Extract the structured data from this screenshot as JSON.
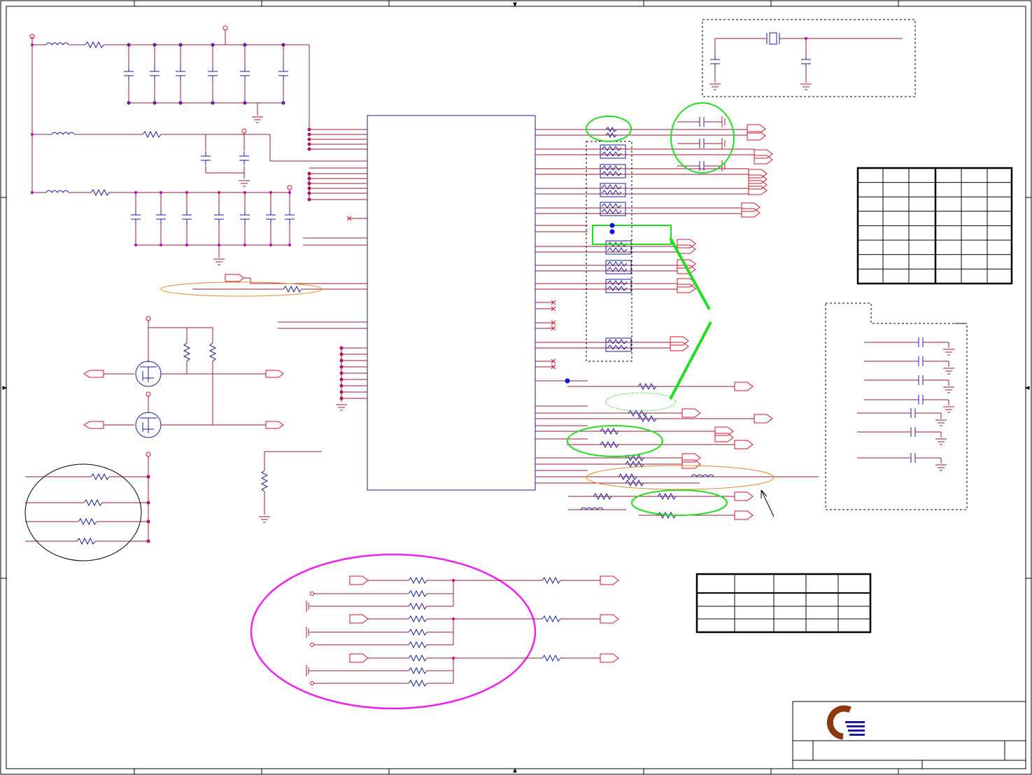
{
  "sheet": {
    "title": "",
    "border_color": "#000000",
    "wire_color": "#9b1b30",
    "net_color": "#d4102a",
    "component_color": "#1a1aa0",
    "junction_color": "#c000c0",
    "highlight_green": "#22dd22",
    "highlight_magenta": "#ee22ee",
    "highlight_orange": "#e08a2a"
  },
  "title_block": {
    "logo": "company-logo",
    "rows": 3
  },
  "tables": {
    "right_table": {
      "rows": 8,
      "cols": 6
    },
    "bottom_table": {
      "rows": 3,
      "cols": 5
    }
  }
}
